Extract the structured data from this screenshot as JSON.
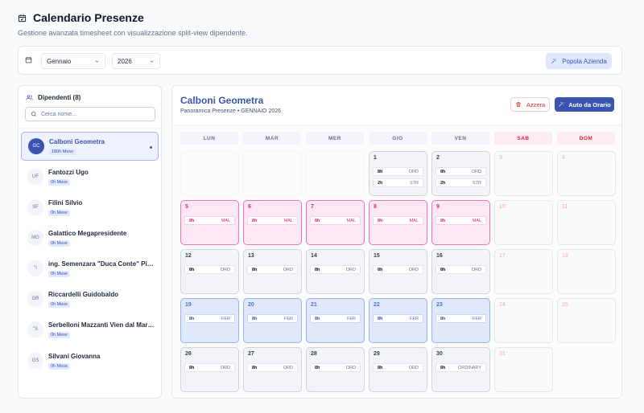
{
  "header": {
    "title": "Calendario Presenze",
    "subtitle": "Gestione avanzata timesheet con visualizzazione split-view dipendente."
  },
  "filters": {
    "month": "Gennaio",
    "year": "2026",
    "popola_label": "Popola Azienda"
  },
  "sidebar": {
    "title": "Dipendenti (8)",
    "search_placeholder": "Cerca nome...",
    "employees": [
      {
        "initials": "GC",
        "name": "Calboni Geometra",
        "hours": "180h Mese"
      },
      {
        "initials": "UF",
        "name": "Fantozzi Ugo",
        "hours": "0h Mese"
      },
      {
        "initials": "SF",
        "name": "Filini Silvio",
        "hours": "0h Mese"
      },
      {
        "initials": "MG",
        "name": "Galattico Megapresidente",
        "hours": "0h Mese"
      },
      {
        "initials": "\"I",
        "name": "ing. Semenzara \"Duca Conte\" Pier...",
        "hours": "0h Mese"
      },
      {
        "initials": "GR",
        "name": "Riccardelli Guidobaldo",
        "hours": "0h Mese"
      },
      {
        "initials": "\"S",
        "name": "Serbelloni Mazzanti Vien dal Mare...",
        "hours": "0h Mese"
      },
      {
        "initials": "GS",
        "name": "Silvani Giovanna",
        "hours": "0h Mese"
      }
    ]
  },
  "main": {
    "title": "Calboni Geometra",
    "subtitle": "Panoramica Presenze • GENNAIO 2026",
    "azzera_label": "Azzera",
    "auto_label": "Auto da Orario",
    "weekdays": [
      "LUN",
      "MAR",
      "MER",
      "GIO",
      "VEN",
      "SAB",
      "DOM"
    ],
    "weekend_dash": "-",
    "days": [
      {
        "num": "1",
        "entries": [
          {
            "h": "8h",
            "t": "ORD"
          },
          {
            "h": "2h",
            "t": "STR"
          }
        ]
      },
      {
        "num": "2",
        "entries": [
          {
            "h": "8h",
            "t": "ORD"
          },
          {
            "h": "2h",
            "t": "STR"
          }
        ]
      },
      {
        "num": "3"
      },
      {
        "num": "4"
      },
      {
        "num": "5",
        "entries": [
          {
            "h": "8h",
            "t": "MAL"
          }
        ]
      },
      {
        "num": "6",
        "entries": [
          {
            "h": "8h",
            "t": "MAL"
          }
        ]
      },
      {
        "num": "7",
        "entries": [
          {
            "h": "8h",
            "t": "MAL"
          }
        ]
      },
      {
        "num": "8",
        "entries": [
          {
            "h": "8h",
            "t": "MAL"
          }
        ]
      },
      {
        "num": "9",
        "entries": [
          {
            "h": "8h",
            "t": "MAL"
          }
        ]
      },
      {
        "num": "10"
      },
      {
        "num": "11"
      },
      {
        "num": "12",
        "entries": [
          {
            "h": "8h",
            "t": "ORD"
          }
        ]
      },
      {
        "num": "13",
        "entries": [
          {
            "h": "8h",
            "t": "ORD"
          }
        ]
      },
      {
        "num": "14",
        "entries": [
          {
            "h": "8h",
            "t": "ORD"
          }
        ]
      },
      {
        "num": "15",
        "entries": [
          {
            "h": "8h",
            "t": "ORD"
          }
        ]
      },
      {
        "num": "16",
        "entries": [
          {
            "h": "8h",
            "t": "ORD"
          }
        ]
      },
      {
        "num": "17"
      },
      {
        "num": "18"
      },
      {
        "num": "19",
        "entries": [
          {
            "h": "8h",
            "t": "FER"
          }
        ]
      },
      {
        "num": "20",
        "entries": [
          {
            "h": "8h",
            "t": "FER"
          }
        ]
      },
      {
        "num": "21",
        "entries": [
          {
            "h": "8h",
            "t": "FER"
          }
        ]
      },
      {
        "num": "22",
        "entries": [
          {
            "h": "8h",
            "t": "FER"
          }
        ]
      },
      {
        "num": "23",
        "entries": [
          {
            "h": "8h",
            "t": "FER"
          }
        ]
      },
      {
        "num": "24"
      },
      {
        "num": "25"
      },
      {
        "num": "26",
        "entries": [
          {
            "h": "8h",
            "t": "ORD"
          }
        ]
      },
      {
        "num": "27",
        "entries": [
          {
            "h": "8h",
            "t": "ORD"
          }
        ]
      },
      {
        "num": "28",
        "entries": [
          {
            "h": "8h",
            "t": "ORD"
          }
        ]
      },
      {
        "num": "29",
        "entries": [
          {
            "h": "8h",
            "t": "ORD"
          }
        ]
      },
      {
        "num": "30",
        "entries": [
          {
            "h": "8h",
            "t": "ORDINARY"
          }
        ]
      },
      {
        "num": "31"
      }
    ]
  }
}
